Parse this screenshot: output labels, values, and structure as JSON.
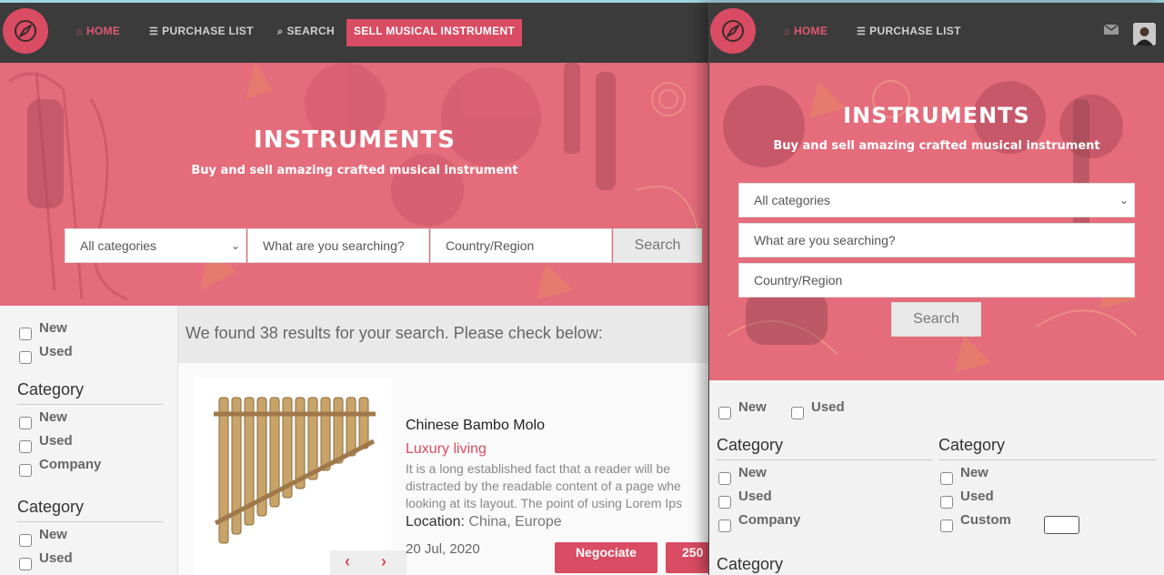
{
  "colors": {
    "accent": "#d94c63",
    "navbar": "#3b3b3b",
    "hero": "#e46c7c"
  },
  "left": {
    "nav": {
      "logo_icon": "compass-icon",
      "home": "HOME",
      "purchase_list": "PURCHASE LIST",
      "search": "SEARCH",
      "sell": "SELL MUSICAL INSTRUMENT"
    },
    "hero": {
      "title": "INSTRUMENTS",
      "subtitle": "Buy and sell amazing crafted musical instrument",
      "category_select": "All categories",
      "search_placeholder": "What are you searching?",
      "region_placeholder": "Country/Region",
      "search_button": "Search"
    },
    "filters": {
      "condition": [
        "New",
        "Used"
      ],
      "group1_title": "Category",
      "group1": [
        "New",
        "Used",
        "Company"
      ],
      "group2_title": "Category",
      "group2": [
        "New",
        "Used"
      ]
    },
    "results_text": "We found 38 results for your search. Please check below:",
    "product": {
      "name": "Chinese Bambo Molo",
      "category": "Luxury living",
      "description_lines": [
        "It is a long established fact that a reader will be",
        "distracted by the readable content of a page whe",
        "looking at its layout. The point of using Lorem Ips"
      ],
      "location_label": "Location:",
      "location": "China, Europe",
      "date": "20 Jul, 2020",
      "negotiate": "Negociate",
      "price": "250"
    }
  },
  "right": {
    "nav": {
      "logo_icon": "compass-icon",
      "home": "HOME",
      "purchase_list": "PURCHASE LIST",
      "mail_icon": "envelope-icon",
      "avatar": "user-avatar"
    },
    "hero": {
      "title": "INSTRUMENTS",
      "subtitle": "Buy and sell amazing crafted musical instrument",
      "category_select": "All categories",
      "search_placeholder": "What are you searching?",
      "region_placeholder": "Country/Region",
      "search_button": "Search"
    },
    "filters": {
      "condition": [
        "New",
        "Used"
      ],
      "col1_title": "Category",
      "col1": [
        "New",
        "Used",
        "Company"
      ],
      "col2_title": "Category",
      "col2": [
        "New",
        "Used",
        "Custom"
      ],
      "bottom_title": "Category"
    }
  }
}
